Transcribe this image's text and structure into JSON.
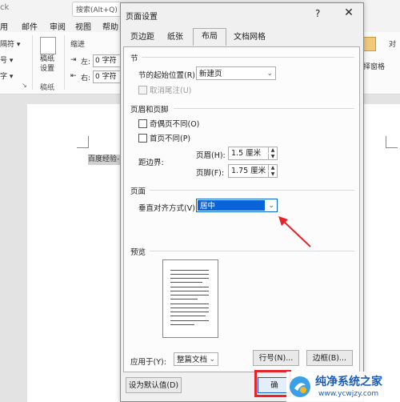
{
  "word": {
    "title": "ck",
    "search_text": "搜索(Alt+Q)",
    "tabs": [
      "用",
      "邮件",
      "审阅",
      "视图",
      "帮助"
    ],
    "ribbon": {
      "left_items": [
        "隔符 ▾",
        "号 ▾",
        "字 ▾"
      ],
      "gaozhi_label": "稿纸\n设置",
      "gaozhi_group": "稿纸",
      "indent_header": "缩进",
      "indent_left_label": "左:",
      "indent_left_value": "0 字符",
      "indent_right_label": "右:",
      "indent_right_value": "0 字符",
      "right_label": "择窗格",
      "right_small": "对"
    },
    "doc_text": "百度经验-"
  },
  "dialog": {
    "title": "页面设置",
    "help": "?",
    "close": "✕",
    "tabs": [
      {
        "label": "页边距",
        "active": false
      },
      {
        "label": "纸张",
        "active": false
      },
      {
        "label": "布局",
        "active": true
      },
      {
        "label": "文档网格",
        "active": false
      }
    ],
    "section": {
      "title": "节",
      "start_label": "节的起始位置(R):",
      "start_value": "新建页",
      "suppress_endnotes": "取消尾注(U)"
    },
    "headers_footers": {
      "title": "页眉和页脚",
      "odd_even": "奇偶页不同(O)",
      "first_page": "首页不同(P)",
      "from_edge": "距边界:",
      "header_label": "页眉(H):",
      "header_value": "1.5 厘米",
      "footer_label": "页脚(F):",
      "footer_value": "1.75 厘米"
    },
    "page": {
      "title": "页面",
      "valign_label": "垂直对齐方式(V):",
      "valign_value": "居中"
    },
    "preview": {
      "title": "预览"
    },
    "apply_label": "应用于(Y):",
    "apply_value": "整篇文档",
    "line_numbers_button": "行号(N)...",
    "borders_button": "边框(B)...",
    "default_button": "设为默认值(D)",
    "ok_button": "确"
  },
  "watermark": {
    "brand": "纯净系统之家",
    "url": "www.ycwjzy.com"
  },
  "colors": {
    "accent_blue": "#0a64d8",
    "annotation_red": "#e8212a"
  }
}
